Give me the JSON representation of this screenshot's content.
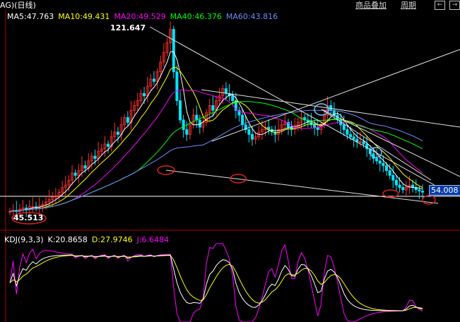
{
  "topbar": {
    "overlay_label": "商品叠加",
    "period_label": "周期",
    "nav_prev": "←",
    "nav_next": "→"
  },
  "price_pane": {
    "symbol_label": "AG)(日线)",
    "legend": [
      {
        "text": "MA5:47.763",
        "color": "#ffffff"
      },
      {
        "text": "MA10:49.431",
        "color": "#ffff00"
      },
      {
        "text": "MA20:49.529",
        "color": "#ff00ff"
      },
      {
        "text": "MA40:46.376",
        "color": "#00ff00"
      },
      {
        "text": "MA60:43.816",
        "color": "#6a8cff"
      }
    ],
    "high_label": "121.647",
    "low_label": "45.513",
    "last_price": "54.008"
  },
  "kdj_pane": {
    "legend": [
      {
        "text": "KDJ(9,3,3)",
        "color": "#ffffff"
      },
      {
        "text": "K:20.8658",
        "color": "#ffffff"
      },
      {
        "text": "D:27.9746",
        "color": "#ffff00"
      },
      {
        "text": "J:6.6484",
        "color": "#ff00ff"
      }
    ]
  },
  "chart_data": {
    "type": "line",
    "title": "AG)(日线)",
    "price_ylim": [
      40,
      125
    ],
    "kdj_ylim": [
      -20,
      120
    ],
    "ma_values": {
      "MA5": 47.763,
      "MA10": 49.431,
      "MA20": 49.529,
      "MA40": 46.376,
      "MA60": 43.816
    },
    "kdj_values": {
      "K": 20.8658,
      "D": 27.9746,
      "J": 6.6484
    },
    "annotations": {
      "high": 121.647,
      "low": 45.513,
      "last": 54.008
    },
    "close_series": [
      46,
      46.5,
      46,
      47,
      47.5,
      47,
      48,
      48,
      47.5,
      48.5,
      49,
      50,
      51,
      52,
      52.5,
      54,
      56,
      57,
      59,
      62,
      61,
      63,
      65,
      64,
      67,
      69,
      68,
      71,
      72,
      74,
      73,
      77,
      79,
      78,
      82,
      85,
      83,
      88,
      90,
      92,
      95,
      94,
      98,
      101,
      100,
      104,
      108,
      112,
      116,
      121.6,
      104,
      92,
      84,
      80,
      78,
      82,
      86,
      84,
      81,
      83,
      87,
      90,
      88,
      92,
      94,
      97,
      95,
      94,
      92,
      88,
      86,
      82,
      80,
      78,
      76,
      77,
      79,
      80,
      81,
      80,
      79,
      78,
      80,
      82,
      83,
      81,
      80,
      81,
      83,
      85,
      84,
      83,
      82,
      81,
      80,
      82,
      86,
      90,
      88,
      86,
      84,
      82,
      80,
      78,
      77,
      76,
      75,
      75,
      74,
      72,
      70,
      68,
      67,
      66,
      65,
      63,
      61,
      59,
      57,
      56,
      55,
      56,
      57,
      56,
      55,
      54.5,
      54
    ]
  }
}
